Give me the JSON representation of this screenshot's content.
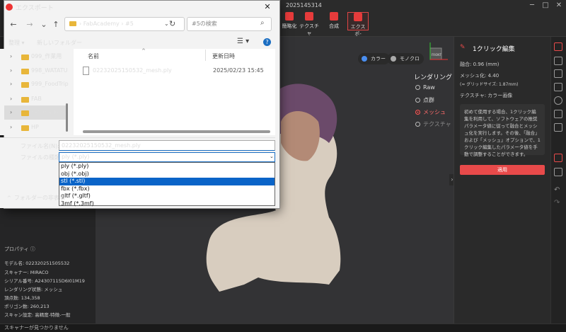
{
  "app": {
    "title": "2025145314",
    "toolbar": [
      {
        "label": "簡略化"
      },
      {
        "label": "テクスチャ"
      },
      {
        "label": "合成"
      },
      {
        "label": "エクスポ-"
      }
    ]
  },
  "viewport": {
    "mode_color": "カラー",
    "mode_mono": "モノクロ",
    "rendering_title": "レンダリング",
    "rendering_options": [
      "Raw",
      "点群",
      "メッシュ",
      "テクスチャ"
    ],
    "axis_label": "FRONT",
    "collapse_arrow": "›"
  },
  "right_panel": {
    "title": "1クリック編集",
    "fusion": "融合:  0.96 (mm)",
    "mesh": "メッシュ化:  4.40",
    "grid_note": "(≈ グリッドサイズ: 1.87mm)",
    "texture": "テクスチャ: カラー画像",
    "info": "初めて使用する場合、1クリック編集を利用して、ソフトウェアの推奨パラメータ値に従って融合とメッシュ化を実行します。その後、「融合」および「メッシュ」オプションで、1クリック編集したパラメータ値を手動で調整することができます。",
    "apply": "適用"
  },
  "left_panel": {
    "properties_title": "プロパティ  ⓘ",
    "props": [
      "モデル名: 022320251505532",
      "スキャナー: MIRACO",
      "シリアル番号: A24307115D6I01M19",
      "レンダリング状態: メッシュ",
      "頂点数: 134,358",
      "ポリゴン数: 260,213",
      "スキャン設定: 高精度-特徴-一般"
    ]
  },
  "status": "スキャナーが見つかりません",
  "dialog": {
    "title": "エクスポート",
    "close": "✕",
    "nav": {
      "back": "←",
      "forward": "→",
      "dropdown": "⌄",
      "up": "↑"
    },
    "breadcrumb": "›  FabAcademy  ›  #5",
    "refresh": "↻",
    "search_placeholder": "#5の検索",
    "organize": "整理 ▾",
    "new_folder": "新しいフォルダー",
    "view": "☰ ▾",
    "help": "?",
    "folders": [
      {
        "name": "099_作業用"
      },
      {
        "name": "998_WATATU"
      },
      {
        "name": "999_FoodTrip"
      },
      {
        "name": "FAB"
      },
      {
        "name": "FabAcademy"
      },
      {
        "name": "HP"
      }
    ],
    "columns": {
      "name": "名前",
      "date": "更新日時"
    },
    "files": [
      {
        "name": "02232025150532_mesh.ply",
        "date": "2025/02/23 15:45"
      }
    ],
    "filename_label": "ファイル名(N):",
    "filename_value": "02232025150532_mesh.ply",
    "filetype_label": "ファイルの種類(T):",
    "filetype_value": "ply (*.ply)",
    "filetype_options": [
      "ply (*.ply)",
      "obj (*.obj)",
      "stl (*.stl)",
      "fbx (*.fbx)",
      "gltf (*.gltf)",
      "3mf (*.3mf)"
    ],
    "hide_folders": "フォルダーの非表示"
  },
  "colors": {
    "accent": "#e84a4a",
    "selection": "#0a64c8"
  }
}
